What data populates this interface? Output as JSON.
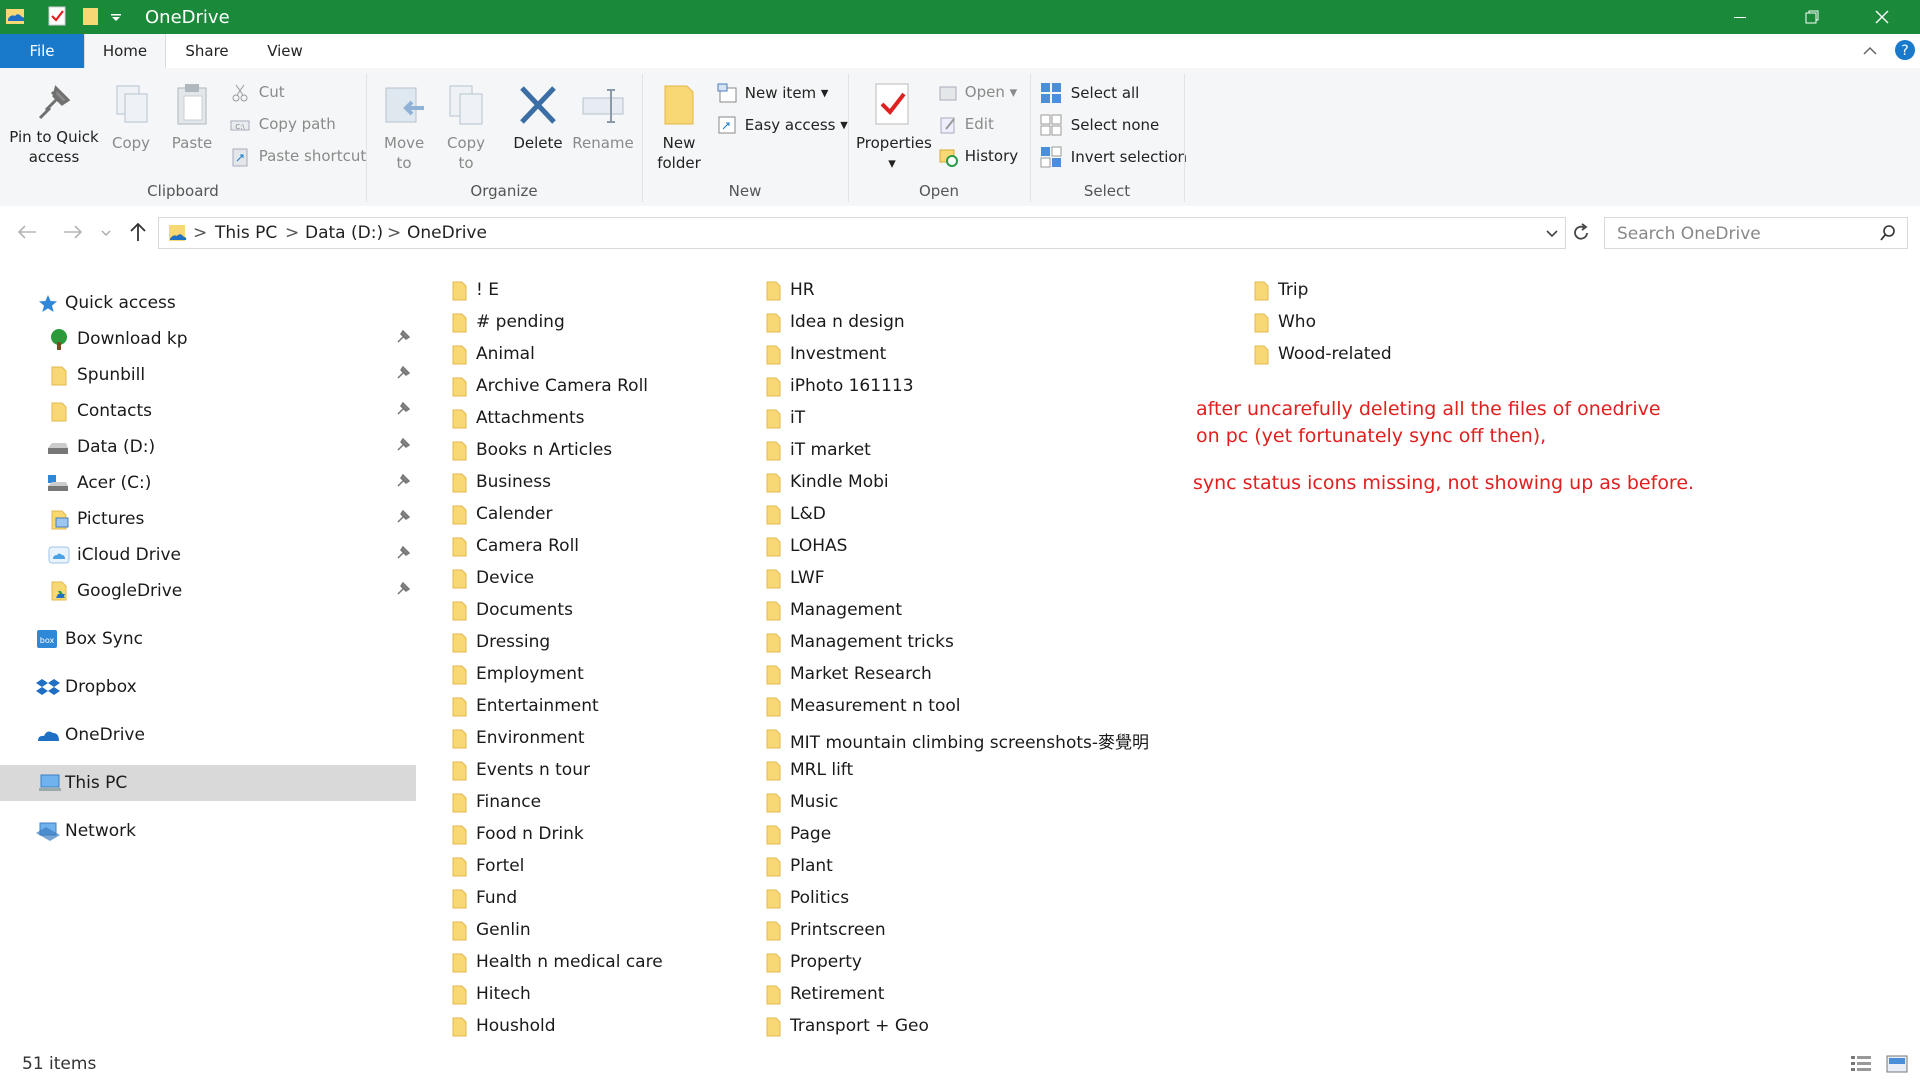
{
  "window": {
    "title": "OneDrive"
  },
  "tabs": {
    "file": "File",
    "home": "Home",
    "share": "Share",
    "view": "View"
  },
  "ribbon": {
    "clipboard": {
      "label": "Clipboard",
      "pin": "Pin to Quick access",
      "copy": "Copy",
      "paste": "Paste",
      "cut": "Cut",
      "copy_path": "Copy path",
      "paste_shortcut": "Paste shortcut"
    },
    "organize": {
      "label": "Organize",
      "move_to": "Move to",
      "copy_to": "Copy to",
      "delete": "Delete",
      "rename": "Rename"
    },
    "new": {
      "label": "New",
      "new_folder": "New folder",
      "new_item": "New item",
      "easy_access": "Easy access"
    },
    "open": {
      "label": "Open",
      "properties": "Properties",
      "open": "Open",
      "edit": "Edit",
      "history": "History"
    },
    "select": {
      "label": "Select",
      "select_all": "Select all",
      "select_none": "Select none",
      "invert": "Invert selection"
    }
  },
  "address": {
    "crumbs": [
      "This PC",
      "Data (D:)",
      "OneDrive"
    ]
  },
  "search": {
    "placeholder": "Search OneDrive"
  },
  "nav": {
    "quick_access": "Quick access",
    "pinned": [
      "Download kp",
      "Spunbill",
      "Contacts",
      "Data (D:)",
      "Acer (C:)",
      "Pictures",
      "iCloud Drive",
      "GoogleDrive"
    ],
    "box_sync": "Box Sync",
    "dropbox": "Dropbox",
    "onedrive": "OneDrive",
    "this_pc": "This PC",
    "network": "Network"
  },
  "files": {
    "col1": [
      "! E",
      "# pending",
      "Animal",
      "Archive Camera Roll",
      "Attachments",
      "Books n Articles",
      "Business",
      "Calender",
      "Camera Roll",
      "Device",
      "Documents",
      "Dressing",
      "Employment",
      "Entertainment",
      "Environment",
      "Events n tour",
      "Finance",
      "Food n Drink",
      "Fortel",
      "Fund",
      "Genlin",
      "Health n medical care",
      "Hitech",
      "Houshold"
    ],
    "col2": [
      "HR",
      "Idea n design",
      "Investment",
      "iPhoto 161113",
      "iT",
      "iT market",
      "Kindle Mobi",
      "L&D",
      "LOHAS",
      "LWF",
      "Management",
      "Management tricks",
      "Market Research",
      "Measurement n tool",
      "MIT mountain climbing screenshots-麥覺明",
      "MRL lift",
      "Music",
      "Page",
      "Plant",
      "Politics",
      "Printscreen",
      "Property",
      "Retirement",
      "Transport + Geo"
    ],
    "col3": [
      "Trip",
      "Who",
      "Wood-related"
    ]
  },
  "annotation": {
    "line1": "after uncarefully deleting all the files of onedrive",
    "line2": "on pc (yet fortunately sync off then),",
    "line3": "sync status icons missing, not showing up as before."
  },
  "status": {
    "count": "51 items"
  },
  "colors": {
    "titlebar": "#1a8a3a",
    "file_tab": "#1979ca",
    "note": "#e0201e",
    "folder": "#f8d775"
  }
}
